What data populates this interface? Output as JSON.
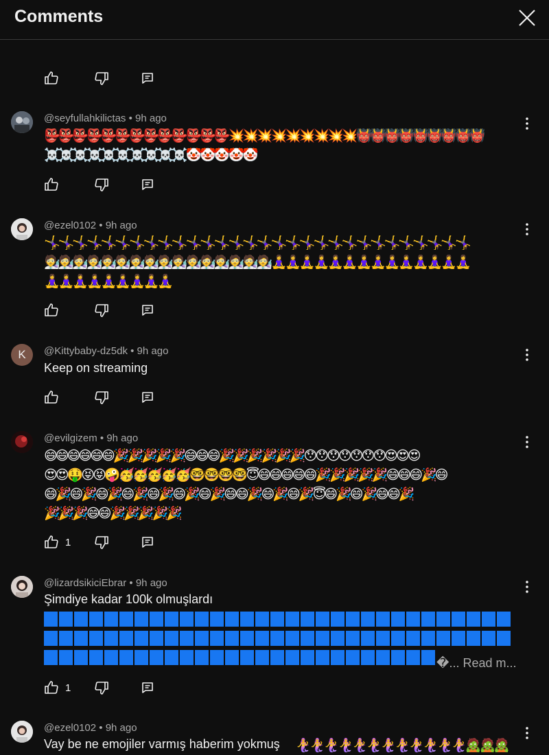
{
  "header": {
    "title": "Comments"
  },
  "comments": [
    {
      "author": "@seyfullahkilictas",
      "time": "9h ago",
      "meta": "@seyfullahkilictas • 9h ago",
      "lines": [
        "👺👺👺👺👺👺👺👺👺👺👺👺👺💥💥💥💥💥💥💥💥💥👹👹👹👹👹👹👹👹👹",
        "☠️☠️☠️☠️☠️☠️☠️☠️☠️☠️🤡🤡🤡🤡🤡"
      ]
    },
    {
      "author": "@ezel0102",
      "time": "9h ago",
      "meta": "@ezel0102 • 9h ago",
      "lines": [
        "🤸‍♀️🤸‍♀️🤸‍♀️🤸‍♀️🤸‍♀️🤸‍♀️🤸‍♀️🤸‍♀️🤸‍♀️🤸‍♀️🤸‍♀️🤸‍♀️🤸‍♀️🤸‍♀️🤸‍♀️🤸‍♀️🤸‍♀️🤸‍♀️🤸‍♀️🤸‍♀️🤸‍♀️🤸‍♀️🤸‍♀️🤸‍♀️🤸‍♀️🤸‍♀️🤸‍♀️🤸‍♀️🤸‍♀️🤸‍♀️",
        "🧑‍🔬🧑‍🔬🧑‍🔬🧑‍🔬🧑‍🔬🧑‍🔬🧑‍🔬🧑‍🔬🧑‍🔬🧑‍🔬🧑‍🔬🧑‍🔬🧑‍🔬🧑‍🔬🧑‍🔬🧑‍🔬🧘‍♀️🧘‍♀️🧘‍♀️🧘‍♀️🧘‍♀️🧘‍♀️🧘‍♀️🧘‍♀️🧘‍♀️🧘‍♀️🧘‍♀️🧘‍♀️🧘‍♀️🧘‍♀️",
        "🧘‍♀️🧘‍♀️🧘‍♀️🧘‍♀️🧘‍♀️🧘‍♀️🧘‍♀️🧘‍♀️🧘‍♀️"
      ]
    },
    {
      "author": "@Kittybaby-dz5dk",
      "time": "9h ago",
      "meta": "@Kittybaby-dz5dk • 9h ago",
      "avatar_letter": "K",
      "text": "Keep on streaming"
    },
    {
      "author": "@evilgizem",
      "time": "9h ago",
      "meta": "@evilgizem • 9h ago",
      "likes": "1",
      "lines": [
        "😄😄😄😄😄😄🎉🎉🎉🎉🎉😄😄😄🎉🎉🎉🎉🎉🎉😯😯😯😯😯😯😯😍😍😍",
        "😍😍🤑😝😝🤪🥳🥳🥳🥳🥳🤓🤓🤓🤓😇😄😄😄😄😄🎉🎉🎉🎉🎉😄😄😄🎉😄",
        "😄🎉😄🎉😄🎉😄🎉😄🎉😄🎉😄🎉😄😄🎉😄🎉😄🎉😇😄🎉😄🎉😄😄🎉",
        "🎉🎉🎉😄😄🎉🎉🎉🎉🎉"
      ]
    },
    {
      "author": "@lizardsikiciEbrar",
      "time": "9h ago",
      "meta": "@lizardsikiciEbrar • 9h ago",
      "likes": "1",
      "text": "Şimdiye kadar 100k olmuşlardı",
      "read_more": "�... Read m..."
    },
    {
      "author": "@ezel0102",
      "time": "9h ago",
      "meta": "@ezel0102 • 9h ago",
      "text": "Vay be ne emojiler varmış haberim yokmuş",
      "lines": [
        "🧜‍♀️🧜‍♀️🧜‍♀️🧜‍♀️🧜‍♀️🧜‍♀️🧜‍♀️🧜‍♀️🧜‍♀️🧜‍♀️🧜‍♀️🧜‍♀️🧟🧟🧟"
      ]
    }
  ],
  "icons": {
    "like": "thumbs-up-icon",
    "dislike": "thumbs-down-icon",
    "reply": "reply-icon",
    "more": "more-vert-icon",
    "close": "close-icon"
  },
  "colors": {
    "background": "#0f0f0f",
    "text": "#f1f1f1",
    "meta": "#aaaaaa",
    "block": "#1877f2"
  }
}
